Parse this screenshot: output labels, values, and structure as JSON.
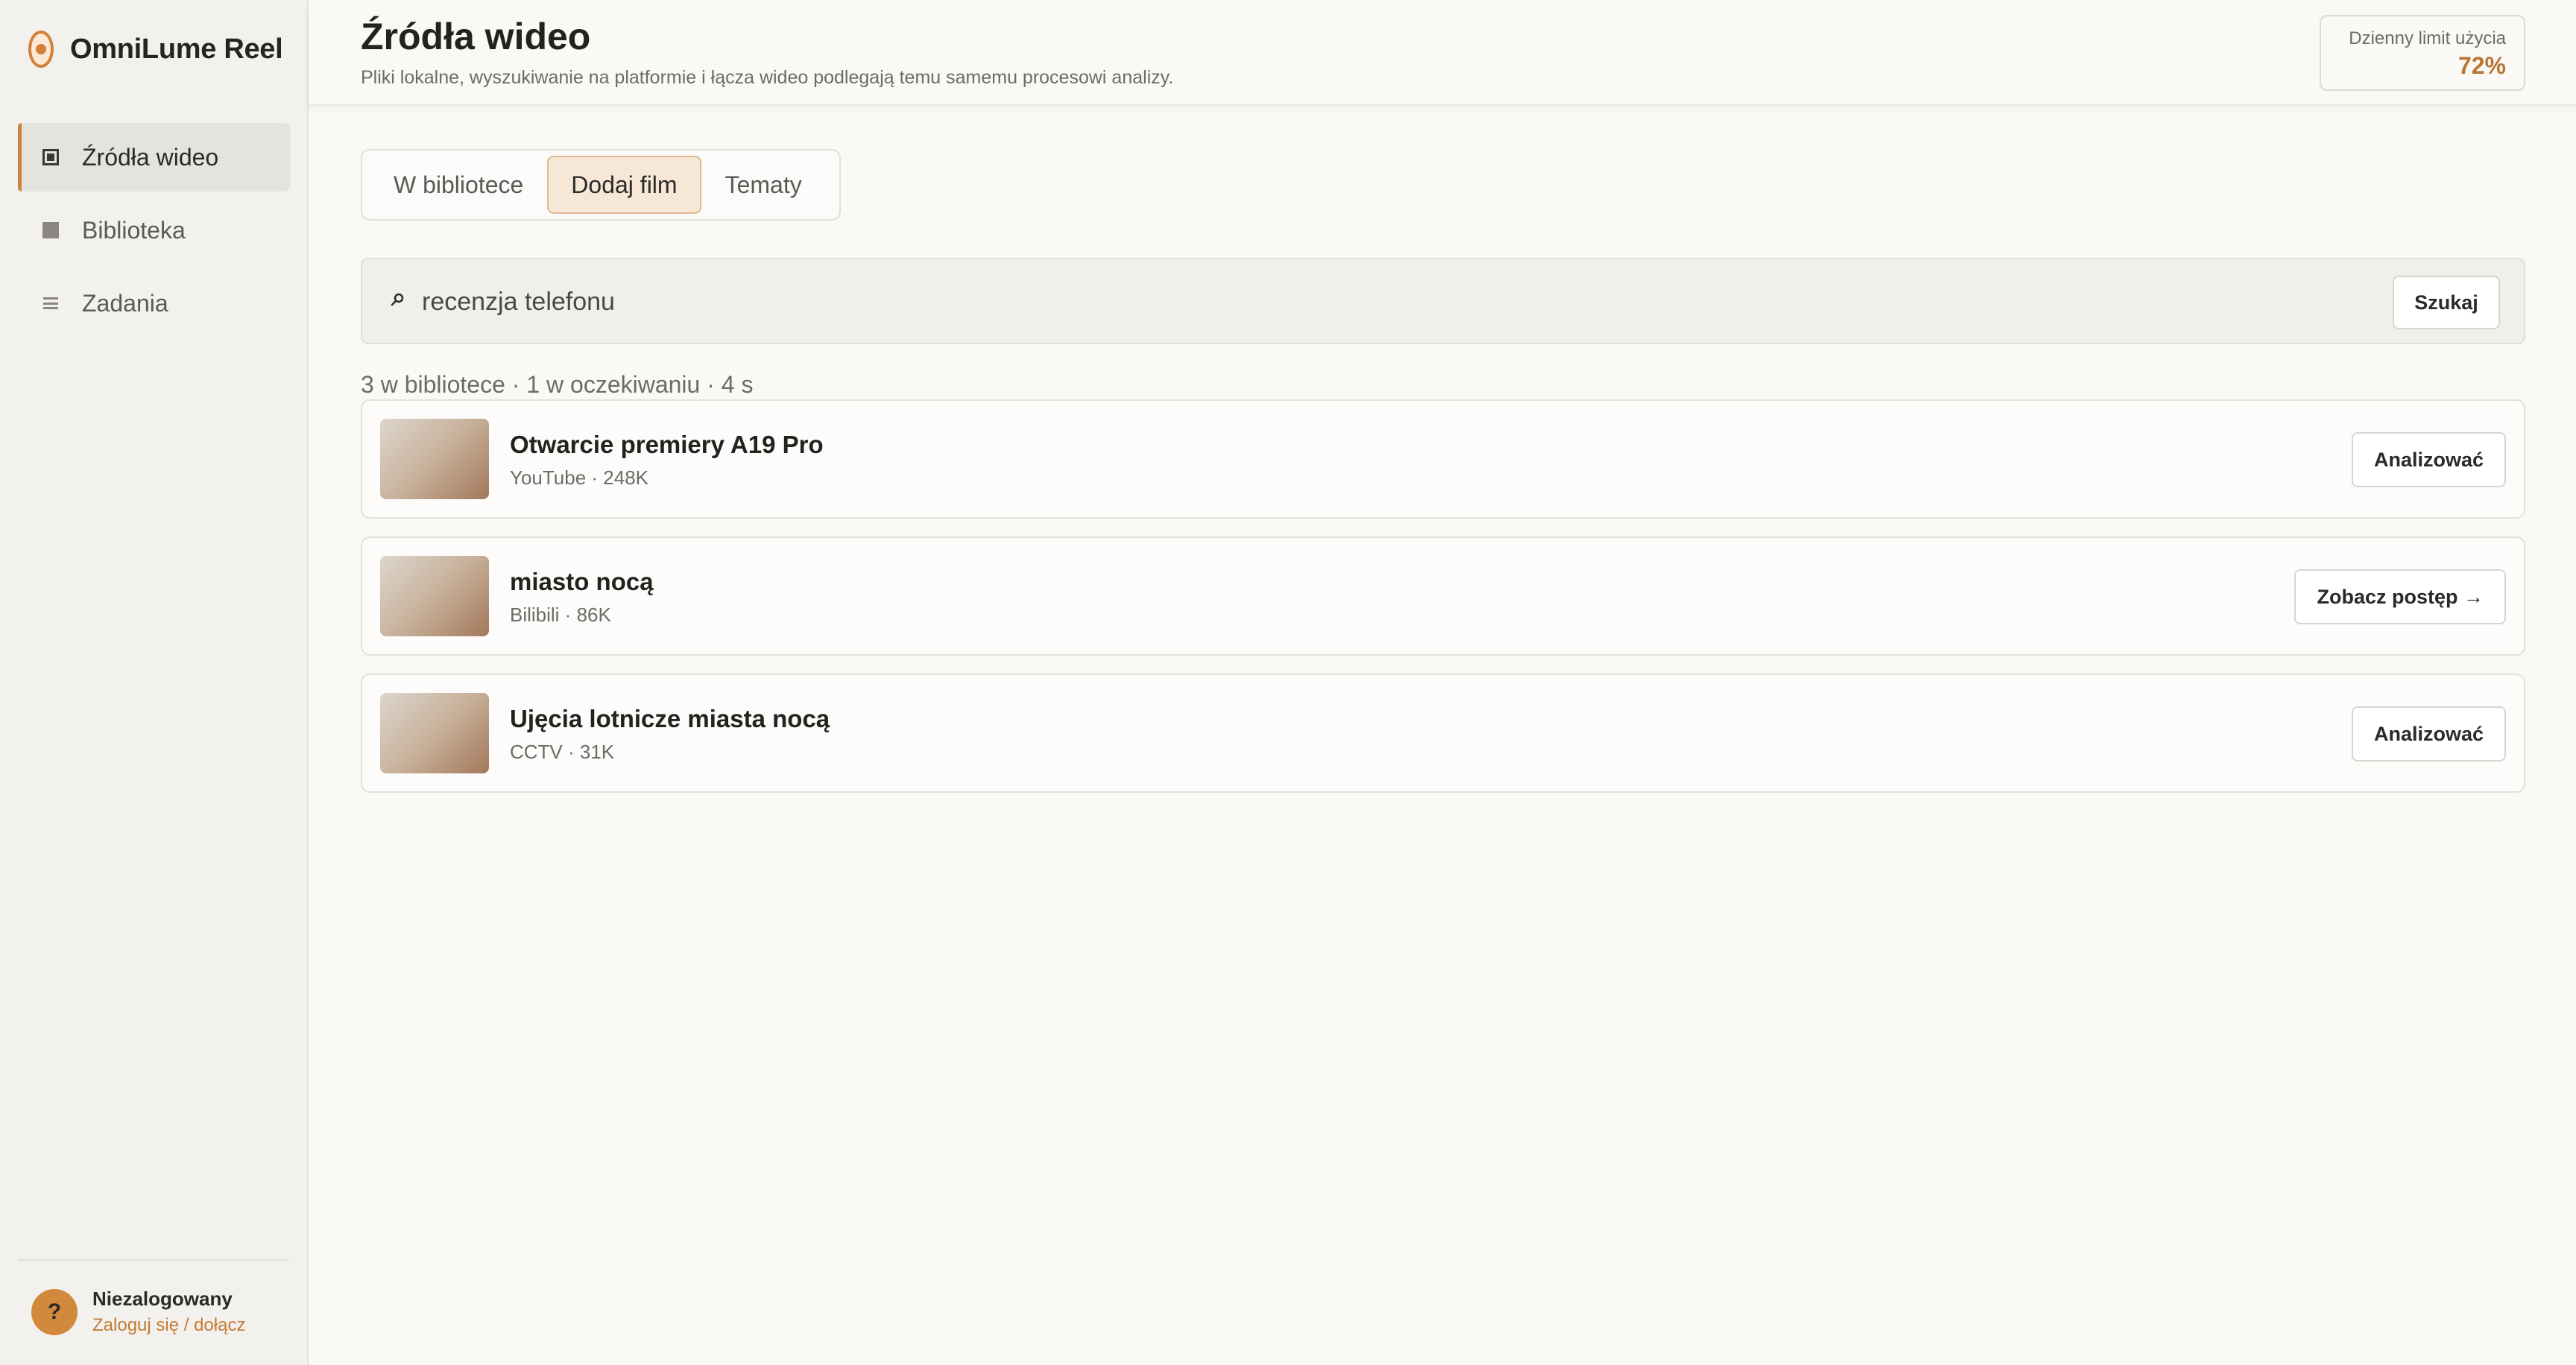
{
  "app": {
    "name": "OmniLume Reel"
  },
  "sidebar": {
    "items": [
      {
        "label": "Źródła wideo",
        "icon": "framed-square-icon",
        "active": true
      },
      {
        "label": "Biblioteka",
        "icon": "square-icon",
        "active": false
      },
      {
        "label": "Zadania",
        "icon": "list-icon",
        "active": false
      }
    ]
  },
  "user": {
    "avatar_symbol": "?",
    "status": "Niezalogowany",
    "login_link": "Zaloguj się / dołącz"
  },
  "header": {
    "title": "Źródła wideo",
    "subtitle": "Pliki lokalne, wyszukiwanie na platformie i łącza wideo podlegają temu samemu procesowi analizy.",
    "usage_label": "Dzienny limit użycia",
    "usage_value": "72%"
  },
  "tabs": [
    {
      "label": "W bibliotece",
      "active": false
    },
    {
      "label": "Dodaj film",
      "active": true
    },
    {
      "label": "Tematy",
      "active": false
    }
  ],
  "search": {
    "value": "recenzja telefonu",
    "button_label": "Szukaj"
  },
  "stats": "3 w bibliotece · 1 w oczekiwaniu · 4 s",
  "results": [
    {
      "title": "Otwarcie premiery A19 Pro",
      "meta": "YouTube · 248K",
      "action": "Analizować"
    },
    {
      "title": "miasto nocą",
      "meta": "Bilibili · 86K",
      "action": "Zobacz postęp →"
    },
    {
      "title": "Ujęcia lotnicze miasta nocą",
      "meta": "CCTV · 31K",
      "action": "Analizować"
    }
  ],
  "colors": {
    "accent": "#c98444",
    "usage_value": "#b87433",
    "login_link": "#c47b34",
    "avatar": "#d2893d"
  }
}
